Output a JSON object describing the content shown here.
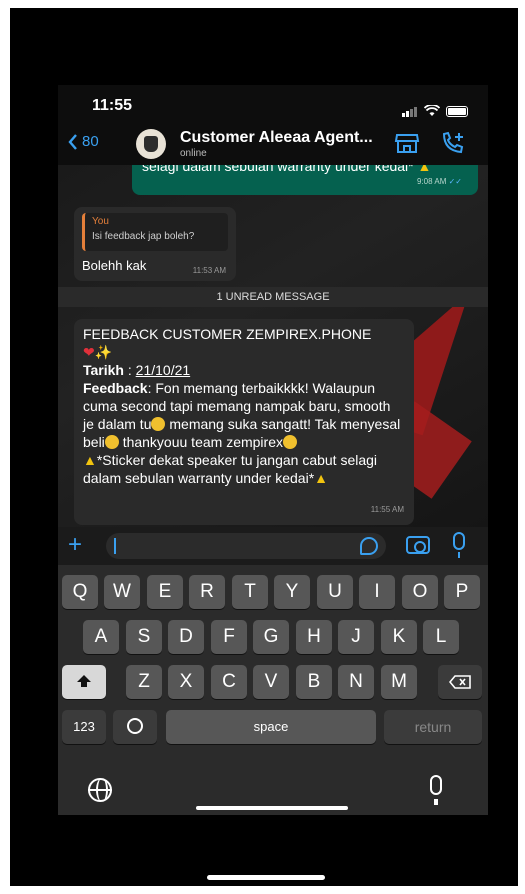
{
  "status_bar": {
    "time": "11:55"
  },
  "header": {
    "back_label": "80",
    "contact_name": "Customer Aleeaa Agent...",
    "contact_status": "online",
    "icons": [
      "store-icon",
      "call-add-icon"
    ]
  },
  "messages": {
    "outgoing_partial": {
      "text": "selagi dalam sebulan warranty under kedai*",
      "time": "9:08 AM"
    },
    "reply": {
      "quote_author": "You",
      "quote_text": "Isi feedback jap boleh?",
      "text": "Bolehh kak",
      "time": "11:53 AM"
    },
    "unread_banner": "1 UNREAD MESSAGE",
    "feedback": {
      "title": "FEEDBACK CUSTOMER ZEMPIREX.PHONE",
      "date_label": "Tarikh",
      "date_value": "21/10/21",
      "feedback_label": "Feedback",
      "feedback_text_1": ": Fon memang terbaikkkk! Walaupun cuma second tapi memang nampak baru, smooth je dalam tu",
      "feedback_text_2": "memang suka sangatt! Tak menyesal beli",
      "feedback_text_3": "thankyouu team zempirex",
      "sticker_note": "*Sticker dekat speaker tu jangan cabut selagi dalam sebulan warranty under kedai*",
      "time": "11:55 AM"
    }
  },
  "keyboard": {
    "row1": [
      "Q",
      "W",
      "E",
      "R",
      "T",
      "Y",
      "U",
      "I",
      "O",
      "P"
    ],
    "row2": [
      "A",
      "S",
      "D",
      "F",
      "G",
      "H",
      "J",
      "K",
      "L"
    ],
    "row3": [
      "Z",
      "X",
      "C",
      "V",
      "B",
      "N",
      "M"
    ],
    "numbers_key": "123",
    "space_key": "space",
    "return_key": "return"
  },
  "colors": {
    "accent": "#3aa0f0",
    "outgoing_bubble": "#05614f",
    "incoming_bubble": "#2a2a2a"
  }
}
